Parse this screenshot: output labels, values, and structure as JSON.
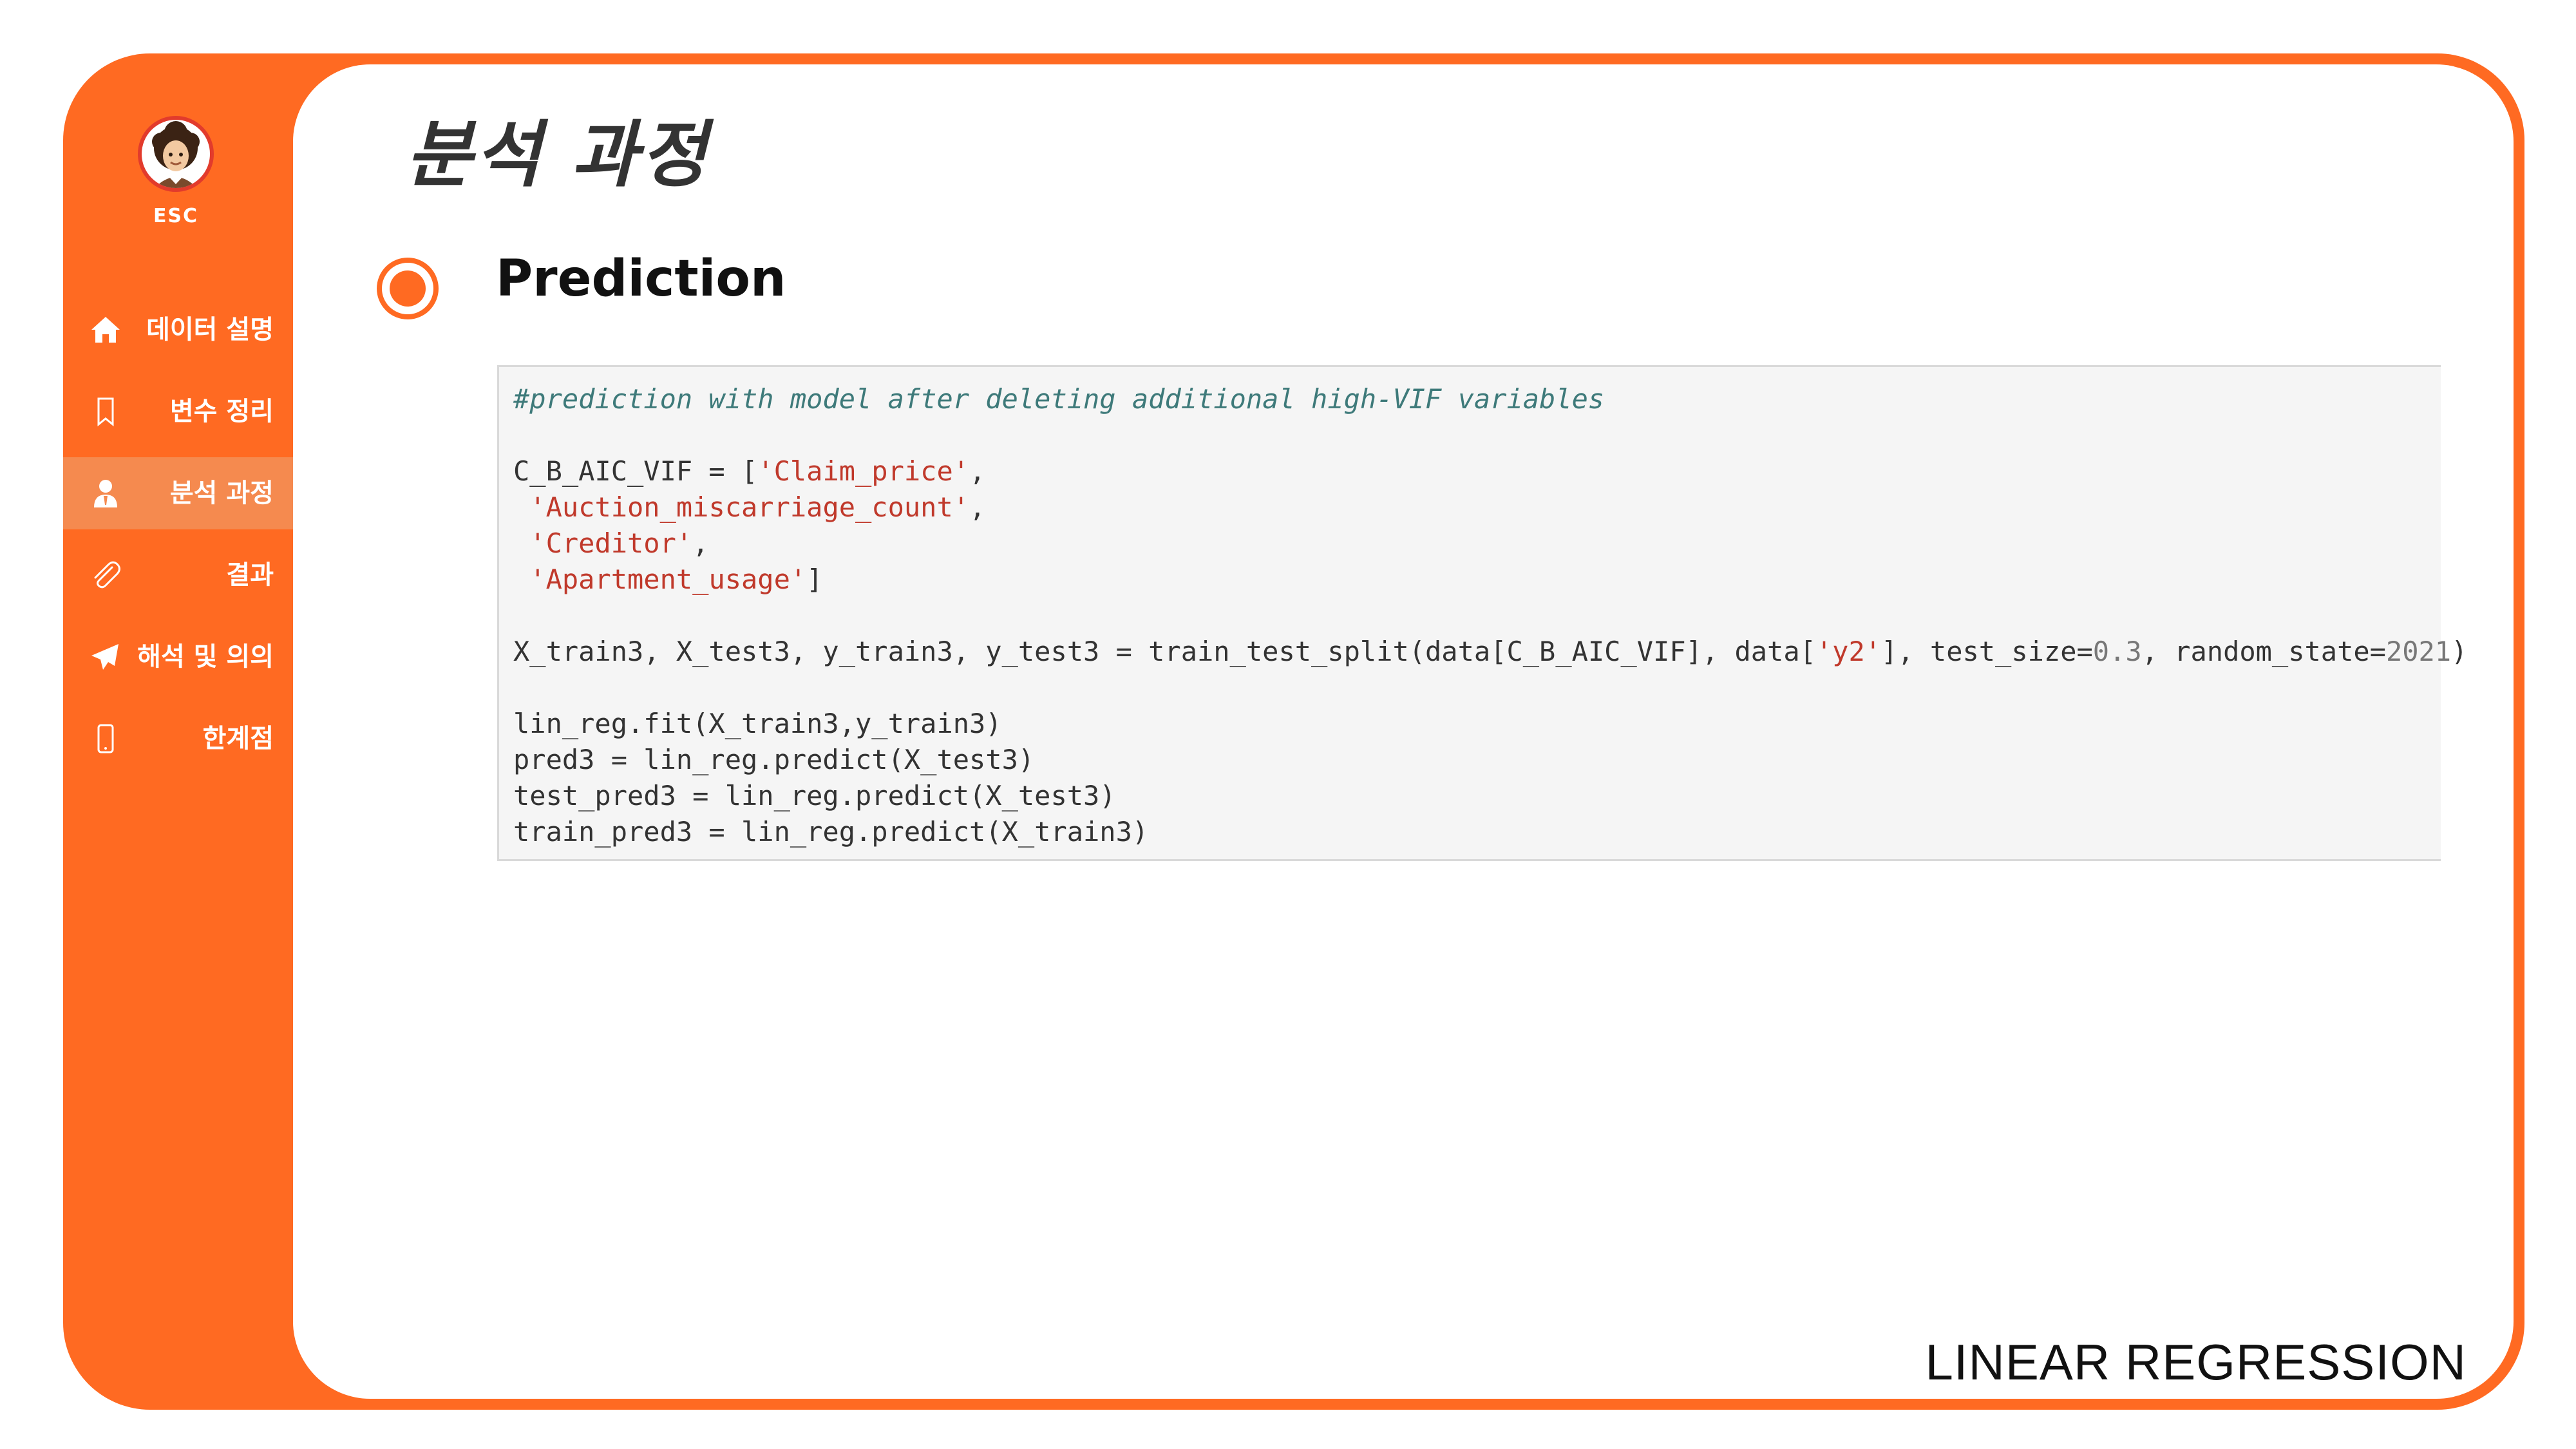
{
  "brand": {
    "avatar_icon": "afro-person-avatar-icon",
    "label": "ESC"
  },
  "sidebar": {
    "items": [
      {
        "icon": "home-icon",
        "label": "데이터 설명",
        "active": false
      },
      {
        "icon": "bookmark-icon",
        "label": "변수 정리",
        "active": false
      },
      {
        "icon": "user-tie-icon",
        "label": "분석 과정",
        "active": true
      },
      {
        "icon": "paperclip-icon",
        "label": "결과",
        "active": false
      },
      {
        "icon": "paper-plane-icon",
        "label": "해석 및 의의",
        "active": false
      },
      {
        "icon": "mobile-icon",
        "label": "한계점",
        "active": false
      }
    ]
  },
  "main": {
    "page_title": "분석 과정",
    "section_title": "Prediction",
    "code": {
      "comment": "#prediction with model after deleting additional high-VIF variables",
      "line_vars_prefix": "C_B_AIC_VIF = [",
      "var1": "'Claim_price'",
      "var2": "'Auction_miscarriage_count'",
      "var3": "'Creditor'",
      "var4": "'Apartment_usage'",
      "split_prefix": "X_train3, X_test3, y_train3, y_test3 = train_test_split(data[C_B_AIC_VIF], data[",
      "split_target": "'y2'",
      "split_mid": "], test_size=",
      "split_test_size": "0.3",
      "split_rs_label": ", random_state=",
      "split_random_state": "2021",
      "fit_line": "lin_reg.fit(X_train3,y_train3)",
      "pred_line": "pred3 = lin_reg.predict(X_test3)",
      "test_pred_line": "test_pred3 = lin_reg.predict(X_test3)",
      "train_pred_line": "train_pred3 = lin_reg.predict(X_train3)"
    }
  },
  "footer": {
    "label": "LINEAR REGRESSION"
  },
  "colors": {
    "accent": "#ff6a22",
    "active_item": "#f58a4f",
    "code_bg": "#f5f5f5",
    "code_string": "#c0392b",
    "code_comment": "#3e7a7a"
  }
}
